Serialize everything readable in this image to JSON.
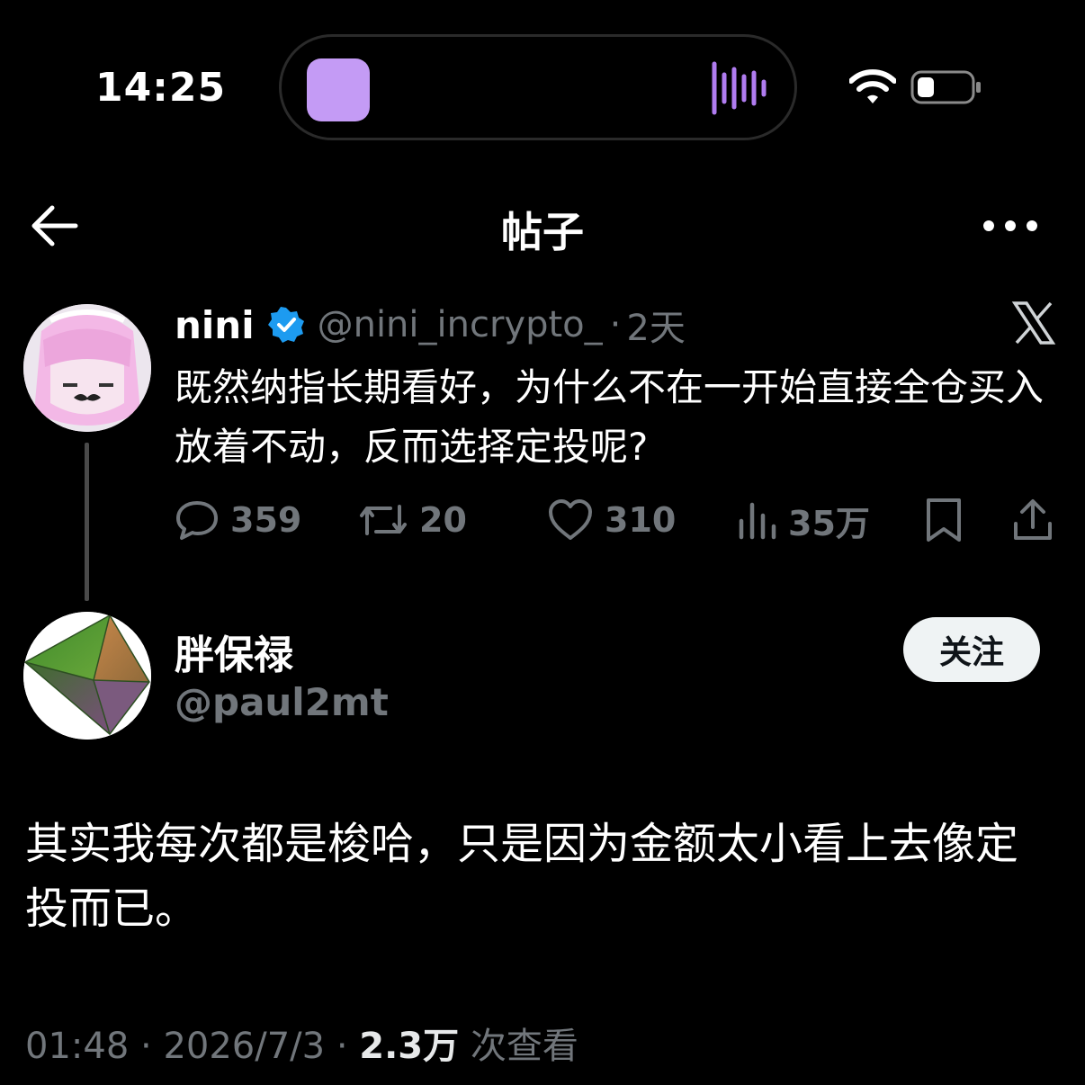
{
  "status_bar": {
    "time": "14:25"
  },
  "header": {
    "title": "帖子"
  },
  "quoted_post": {
    "name": "nini",
    "handle": "@nini_incrypto_",
    "separator": "·",
    "age": "2天",
    "text": "既然纳指长期看好，为什么不在一开始直接全仓买入放着不动，反而选择定投呢?",
    "replies": "359",
    "reposts": "20",
    "likes": "310",
    "views": "35万"
  },
  "post": {
    "author_name": "胖保禄",
    "author_handle": "@paul2mt",
    "follow_label": "关注",
    "text": "其实我每次都是梭哈，只是因为金额太小看上去像定投而已。",
    "time": "01:48",
    "dot": "·",
    "date": "2026/7/3",
    "views_count": "2.3万",
    "views_label": "次查看"
  },
  "colors": {
    "accent": "#1d9bf0",
    "muted": "#71767b",
    "island_app": "#c49bf5"
  }
}
